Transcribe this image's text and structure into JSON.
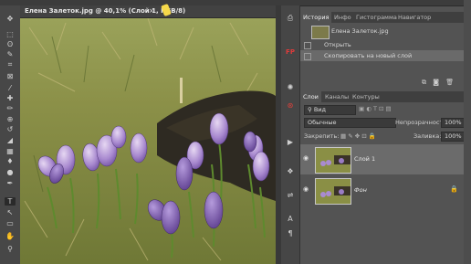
{
  "document": {
    "tab_title": "Елена Залеток.jpg @ 40,1% (Слой 1, RGB/8)",
    "close_glyph": "×"
  },
  "toolbar": {
    "tools": [
      "move-icon",
      "marquee-icon",
      "lasso-icon",
      "quick-select-icon",
      "crop-icon",
      "frame-icon",
      "eyedropper-icon",
      "heal-icon",
      "brush-icon",
      "stamp-icon",
      "history-brush-icon",
      "eraser-icon",
      "gradient-icon",
      "blur-icon",
      "dodge-icon",
      "pen-icon",
      "type-icon",
      "path-select-icon",
      "shape-icon",
      "hand-icon",
      "zoom-icon"
    ],
    "glyphs": [
      "✥",
      "⬚",
      "ʘ",
      "✎",
      "⌗",
      "⊠",
      "⁄",
      "✚",
      "✏",
      "⊕",
      "↺",
      "◢",
      "▦",
      "♦",
      "●",
      "✒",
      "T",
      "↖",
      "▭",
      "✋",
      "⚲"
    ],
    "active_index": 16
  },
  "history": {
    "tabs": [
      "История",
      "Инфо",
      "Гистограмма",
      "Навигатор"
    ],
    "snapshot_name": "Елена Залеток.jpg",
    "steps": [
      "Открыть",
      "Скопировать на новый слой"
    ]
  },
  "layers": {
    "tabs": [
      "Слои",
      "Каналы",
      "Контуры"
    ],
    "filter_label": "Вид",
    "blend_mode": "Обычные",
    "opacity_label": "Непрозрачность:",
    "opacity_value": "100%",
    "lock_label": "Закрепить:",
    "fill_label": "Заливка:",
    "fill_value": "100%",
    "items": [
      {
        "name": "Слой 1"
      },
      {
        "name": "Фон"
      }
    ]
  },
  "side_icons": [
    "history-icon",
    "fp-icon",
    "color-wheel-icon",
    "plugin-icon",
    "play-icon",
    "layers-icon",
    "adjust-icon",
    "text-icon",
    "paragraph-icon"
  ],
  "side_glyphs": [
    "⎙",
    "FP",
    "✺",
    "⊛",
    "▶",
    "❖",
    "⇌",
    "A",
    "¶"
  ]
}
